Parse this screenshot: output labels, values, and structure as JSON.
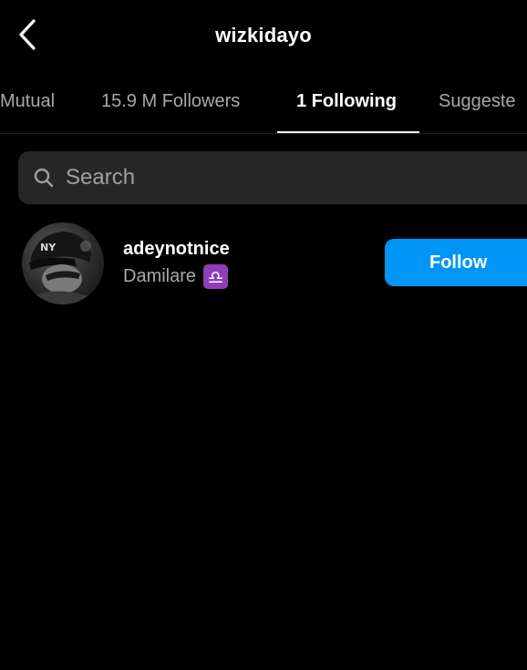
{
  "header": {
    "title": "wizkidayo",
    "back_icon": "chevron-left-icon"
  },
  "tabs": [
    {
      "label": "Mutual",
      "active": false
    },
    {
      "label": "15.9 M Followers",
      "active": false
    },
    {
      "label": "1 Following",
      "active": true
    },
    {
      "label": "Suggeste",
      "active": false
    }
  ],
  "search": {
    "placeholder": "Search",
    "icon": "search-icon"
  },
  "following_list": [
    {
      "username": "adeynotnice",
      "full_name": "Damilare",
      "badge": "♎",
      "badge_color": "#8e3fb8",
      "action_label": "Follow"
    }
  ],
  "colors": {
    "background": "#000000",
    "accent": "#0095f6",
    "secondary_text": "#a8a8a8",
    "search_background": "#262626"
  }
}
